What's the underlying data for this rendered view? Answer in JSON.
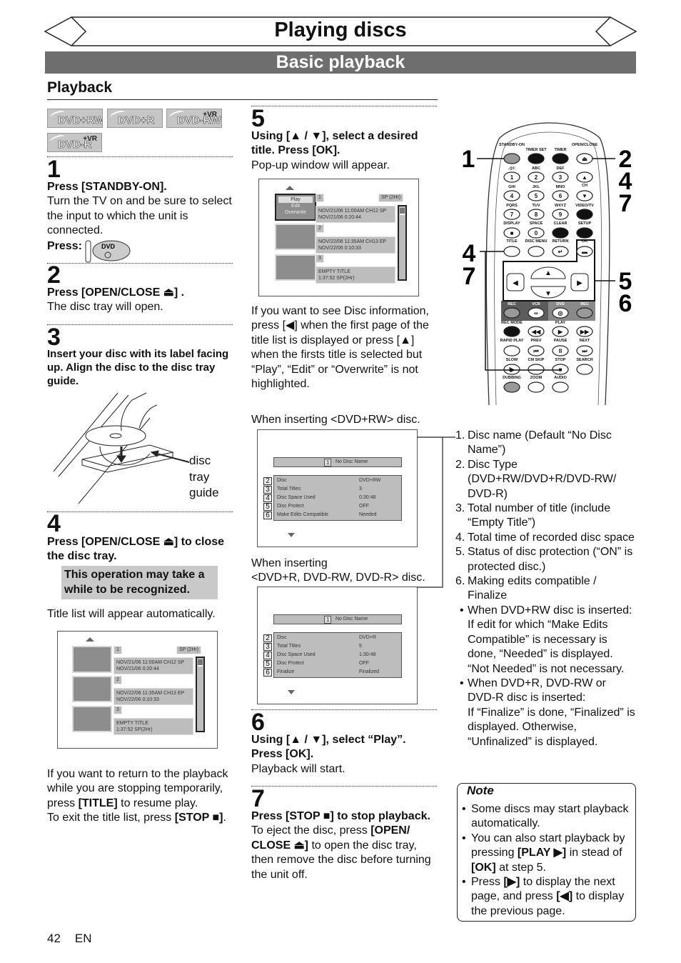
{
  "header": {
    "title": "Playing discs",
    "subtitle": "Basic playback",
    "section": "Playback"
  },
  "disc_logos": [
    {
      "label": "DVD+RW",
      "vr": ""
    },
    {
      "label": "DVD+R",
      "vr": ""
    },
    {
      "label": "DVD-RW",
      "vr": "+VR"
    },
    {
      "label": "DVD-R",
      "vr": "+VR"
    }
  ],
  "steps": {
    "s1": {
      "num": "1",
      "bold": "Press [STANDBY-ON].",
      "text": "Turn the TV on and be sure to select the input to which the unit is connected.",
      "press": "Press:",
      "dvd_button": "DVD"
    },
    "s2": {
      "num": "2",
      "bold": "Press [OPEN/CLOSE ⏏] .",
      "text": "The disc tray will open."
    },
    "s3": {
      "num": "3",
      "bold": "Insert your disc with its label facing up. Align the disc to the disc tray guide.",
      "figure_label": "disc tray guide"
    },
    "s4": {
      "num": "4",
      "bold": "Press [OPEN/CLOSE ⏏] to close the disc tray.",
      "highlight": "This operation may take a while to be recognized.",
      "text": "Title list will appear automatically."
    },
    "s5": {
      "num": "5",
      "bold": "Using [▲ / ▼], select a desired title. Press [OK].",
      "text": "Pop-up window will appear.",
      "info_text": "If you want to see Disc information, press [◀] when the first page of the title list is displayed or press [▲] when the firsts title is selected but “Play”, “Edit” or “Overwrite” is not highlighted.",
      "when_rw": "When inserting <DVD+RW> disc.",
      "when_other_1": "When inserting",
      "when_other_2": "<DVD+R, DVD-RW, DVD-R> disc."
    },
    "s6": {
      "num": "6",
      "bold": "Using [▲ / ▼], select “Play”. Press [OK].",
      "text": "Playback will start."
    },
    "s7": {
      "num": "7",
      "bold": "Press [STOP ■] to stop playback.",
      "text_a": "To eject the disc, press ",
      "text_b": "[OPEN/ CLOSE ⏏]",
      "text_c": " to open the disc tray, then remove the disc before turning the unit off."
    }
  },
  "return_text": {
    "a": "If you want to return to the playback while you are stopping temporarily, press ",
    "b": "[TITLE]",
    "c": " to resume play.",
    "d": "To exit the title list, press ",
    "e": "[STOP ■]",
    "f": "."
  },
  "title_list": {
    "mode": "SP (2Hr)",
    "titles": [
      {
        "num": "1",
        "line1": "NOV/21/06  11:00AM CH12  SP",
        "line2": "NOV/21/06    0:20:44"
      },
      {
        "num": "2",
        "line1": "NOV/22/06  11:35AM CH13  EP",
        "line2": "NOV/22/06    0:10:33"
      },
      {
        "num": "3",
        "line1": "EMPTY TITLE",
        "line2": "1:37:52   SP(2Hr)"
      }
    ],
    "popup": [
      "Play",
      "Edit",
      "Overwrite"
    ]
  },
  "disc_info_rw": {
    "name_num": "1",
    "name": "No Disc Name",
    "rows": [
      {
        "num": "2",
        "label": "Disc",
        "value": "DVD+RW"
      },
      {
        "num": "3",
        "label": "Total Titles",
        "value": "3"
      },
      {
        "num": "4",
        "label": "Disc Space Used",
        "value": "0:30:48"
      },
      {
        "num": "5",
        "label": "Disc Protect",
        "value": "OFF"
      },
      {
        "num": "6",
        "label": "Make Edits Compatible",
        "value": "Needed"
      }
    ]
  },
  "disc_info_r": {
    "name_num": "1",
    "name": "No Disc Name",
    "rows": [
      {
        "num": "2",
        "label": "Disc",
        "value": "DVD+R"
      },
      {
        "num": "3",
        "label": "Total Titles",
        "value": "5"
      },
      {
        "num": "4",
        "label": "Disc Space Used",
        "value": "1:30:48"
      },
      {
        "num": "5",
        "label": "Disc Protect",
        "value": "OFF"
      },
      {
        "num": "6",
        "label": "Finalize",
        "value": "Finalized"
      }
    ]
  },
  "legend": [
    {
      "n": "1.",
      "text": "Disc name (Default “No Disc Name”)"
    },
    {
      "n": "2.",
      "text": "Disc Type (DVD+RW/DVD+R/DVD-RW/ DVD-R)"
    },
    {
      "n": "3.",
      "text": "Total number of title (include “Empty Title”)"
    },
    {
      "n": "4.",
      "text": "Total time of recorded disc space"
    },
    {
      "n": "5.",
      "text": "Status of disc protection (“ON” is protected disc.)"
    },
    {
      "n": "6.",
      "text": "Making edits compatible / Finalize"
    },
    {
      "n": "•",
      "text": "When DVD+RW disc is inserted:"
    },
    {
      "n": "",
      "text": "If edit for which “Make Edits Compatible” is necessary is done, “Needed” is displayed. “Not Needed” is not necessary."
    },
    {
      "n": "•",
      "text": "When DVD+R, DVD-RW or DVD-R disc is inserted:"
    },
    {
      "n": "",
      "text": "If “Finalize” is done, “Finalized” is displayed. Otherwise, “Unfinalized” is displayed."
    }
  ],
  "note": {
    "title": "Note",
    "items": [
      {
        "a": "Some discs may start playback automatically.",
        "b": "",
        "c": "",
        "d": "",
        "e": ""
      },
      {
        "a": "You can also start playback by pressing ",
        "b": "[PLAY ▶]",
        "c": " in stead of ",
        "d": "[OK]",
        "e": " at step 5."
      },
      {
        "a": "Press ",
        "b": "[▶]",
        "c": " to display the next page, and press ",
        "d": "[◀]",
        "e": " to display the previous page."
      }
    ]
  },
  "remote": {
    "callouts": {
      "top_left": "1",
      "top_right": [
        "2",
        "4",
        "7"
      ],
      "mid_left": [
        "4",
        "7"
      ],
      "mid_right": [
        "5",
        "6"
      ]
    },
    "rows": [
      [
        {
          "label": "STANDBY-ON",
          "glyph": "",
          "style": "gray"
        },
        {
          "label": "TIMER SET",
          "glyph": "",
          "style": "black"
        },
        {
          "label": "TIMER",
          "glyph": "",
          "style": "black"
        },
        {
          "label": "OPEN/CLOSE",
          "glyph": "⏏",
          "style": "white"
        }
      ],
      [
        {
          "label": ".@/:",
          "glyph": "1",
          "style": "white"
        },
        {
          "label": "ABC",
          "glyph": "2",
          "style": "white"
        },
        {
          "label": "DEF",
          "glyph": "3",
          "style": "white"
        },
        {
          "label": "",
          "glyph": "▲",
          "style": "white"
        }
      ],
      [
        {
          "label": "GHI",
          "glyph": "4",
          "style": "white"
        },
        {
          "label": "JKL",
          "glyph": "5",
          "style": "white"
        },
        {
          "label": "MNO",
          "glyph": "6",
          "style": "white"
        },
        {
          "label": "CH",
          "glyph": "▼",
          "style": "white"
        }
      ],
      [
        {
          "label": "PQRS",
          "glyph": "7",
          "style": "white"
        },
        {
          "label": "TUV",
          "glyph": "8",
          "style": "white"
        },
        {
          "label": "WXYZ",
          "glyph": "9",
          "style": "white"
        },
        {
          "label": "VIDEO/TV",
          "glyph": "",
          "style": "black"
        }
      ],
      [
        {
          "label": "DISPLAY",
          "glyph": "■",
          "style": "white"
        },
        {
          "label": "SPACE",
          "glyph": "0",
          "style": "white"
        },
        {
          "label": "CLEAR",
          "glyph": "",
          "style": "black"
        },
        {
          "label": "SETUP",
          "glyph": "",
          "style": "black"
        }
      ],
      [
        {
          "label": "TITLE",
          "glyph": "",
          "style": "white"
        },
        {
          "label": "DISC MENU",
          "glyph": "",
          "style": "white"
        },
        {
          "label": "RETURN",
          "glyph": "↵",
          "style": "white"
        },
        {
          "label": "OK",
          "glyph": "▬",
          "style": "white"
        }
      ],
      [
        {
          "label": "REC",
          "glyph": "",
          "style": "gray"
        },
        {
          "label": "VCR",
          "glyph": "∞",
          "style": "white"
        },
        {
          "label": "DVD",
          "glyph": "◎",
          "style": "white"
        },
        {
          "label": "REC",
          "glyph": "",
          "style": "gray"
        }
      ],
      [
        {
          "label": "REC MODE",
          "glyph": "",
          "style": "black"
        },
        {
          "label": "",
          "glyph": "◀◀",
          "style": "white"
        },
        {
          "label": "PLAY",
          "glyph": "▶",
          "style": "white"
        },
        {
          "label": "",
          "glyph": "▶▶",
          "style": "white"
        }
      ],
      [
        {
          "label": "RAPID PLAY",
          "glyph": "",
          "style": "white"
        },
        {
          "label": "PREV",
          "glyph": "⏮",
          "style": "white"
        },
        {
          "label": "PAUSE",
          "glyph": "II",
          "style": "white"
        },
        {
          "label": "NEXT",
          "glyph": "⏭",
          "style": "white"
        }
      ],
      [
        {
          "label": "SLOW",
          "glyph": "I▶",
          "style": "white"
        },
        {
          "label": "CM SKIP",
          "glyph": "",
          "style": "white"
        },
        {
          "label": "STOP",
          "glyph": "■",
          "style": "white"
        },
        {
          "label": "SEARCH",
          "glyph": "",
          "style": "white"
        }
      ],
      [
        {
          "label": "DUBBING",
          "glyph": "",
          "style": "gray"
        },
        {
          "label": "ZOOM",
          "glyph": "",
          "style": "white"
        },
        {
          "label": "AUDIO",
          "glyph": "",
          "style": "white"
        }
      ]
    ],
    "arrows": [
      "▲",
      "▼",
      "◀",
      "▶"
    ]
  },
  "footer": {
    "page": "42",
    "lang": "EN"
  }
}
